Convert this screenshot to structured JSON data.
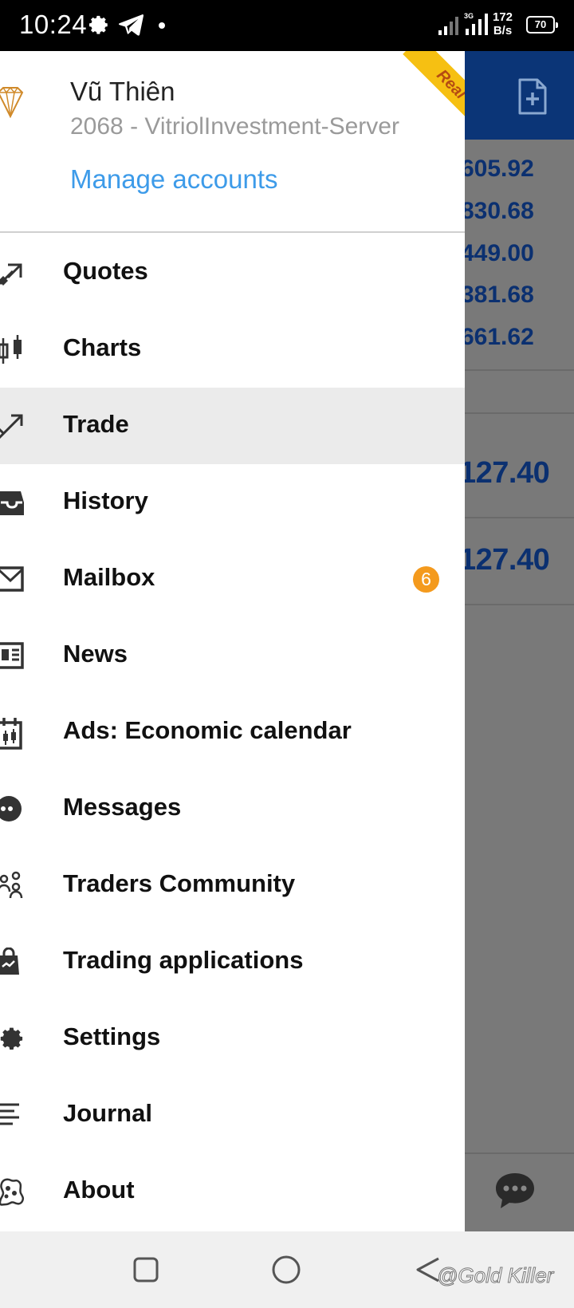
{
  "status_bar": {
    "time": "10:24",
    "icons": [
      "gear-icon",
      "telegram-icon",
      "dot-icon",
      "signal-icon",
      "signal-3g-icon",
      "battery-icon"
    ],
    "speed_line1": "172",
    "speed_line2": "B/s",
    "network_type": "3G",
    "battery": "70"
  },
  "background_app": {
    "header_icon": "add-document-icon",
    "quotes": [
      "605.92",
      "830.68",
      "449.00",
      "381.68",
      "661.62"
    ],
    "big_values": [
      "127.40",
      "127.40"
    ],
    "chat_icon": "chat-bubble-icon",
    "colors": {
      "header": "#0b3577",
      "value_text": "#0b3070",
      "dim_overlay": "#797979"
    }
  },
  "drawer": {
    "account": {
      "name": "Vũ Thiên",
      "server": "2068 - VitriolInvestment-Server",
      "manage_label": "Manage accounts",
      "badge": "Real"
    },
    "menu": [
      {
        "label": "Quotes",
        "icon": "quotes-icon"
      },
      {
        "label": "Charts",
        "icon": "candlestick-icon"
      },
      {
        "label": "Trade",
        "icon": "trade-icon",
        "active": true
      },
      {
        "label": "History",
        "icon": "inbox-icon"
      },
      {
        "label": "Mailbox",
        "icon": "mail-icon",
        "badge": "6"
      },
      {
        "label": "News",
        "icon": "newspaper-icon"
      },
      {
        "label": "Ads: Economic calendar",
        "icon": "calendar-icon"
      },
      {
        "label": "Messages",
        "icon": "messages-icon"
      },
      {
        "label": "Traders Community",
        "icon": "community-icon"
      },
      {
        "label": "Trading applications",
        "icon": "shopping-bag-icon"
      },
      {
        "label": "Settings",
        "icon": "settings-gear-icon"
      },
      {
        "label": "Journal",
        "icon": "journal-icon"
      },
      {
        "label": "About",
        "icon": "about-icon"
      }
    ],
    "colors": {
      "link": "#3d9be9",
      "badge": "#f49a1d",
      "ribbon": "#f6c012",
      "active_row": "#ebebeb"
    }
  },
  "nav_bar": {
    "buttons": [
      "recents-button",
      "home-button",
      "back-button"
    ],
    "watermark": "@Gold Killer"
  }
}
